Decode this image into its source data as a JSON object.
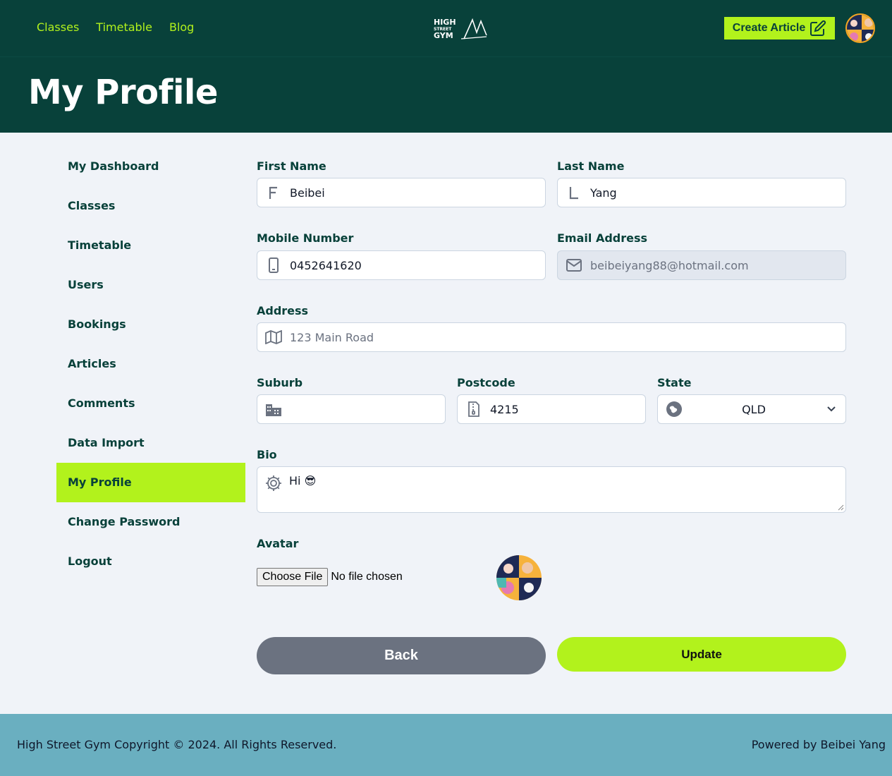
{
  "nav": {
    "links": [
      "Classes",
      "Timetable",
      "Blog"
    ],
    "create_label": "Create Article",
    "logo_text": [
      "HIGH",
      "STREET",
      "GYM"
    ]
  },
  "header": {
    "title": "My Profile"
  },
  "sidebar": {
    "items": [
      {
        "label": "My Dashboard"
      },
      {
        "label": "Classes"
      },
      {
        "label": "Timetable"
      },
      {
        "label": "Users"
      },
      {
        "label": "Bookings"
      },
      {
        "label": "Articles"
      },
      {
        "label": "Comments"
      },
      {
        "label": "Data Import"
      },
      {
        "label": "My Profile",
        "active": true
      },
      {
        "label": "Change Password"
      },
      {
        "label": "Logout"
      }
    ]
  },
  "form": {
    "first_name": {
      "label": "First Name",
      "value": "Beibei"
    },
    "last_name": {
      "label": "Last Name",
      "value": "Yang"
    },
    "mobile": {
      "label": "Mobile Number",
      "value": "0452641620"
    },
    "email": {
      "label": "Email Address",
      "value": "beibeiyang88@hotmail.com"
    },
    "address": {
      "label": "Address",
      "placeholder": "123 Main Road"
    },
    "suburb": {
      "label": "Suburb",
      "value": ""
    },
    "postcode": {
      "label": "Postcode",
      "value": "4215"
    },
    "state": {
      "label": "State",
      "value": "QLD"
    },
    "bio": {
      "label": "Bio",
      "value": "Hi 😎"
    },
    "avatar": {
      "label": "Avatar",
      "button": "Choose File",
      "status": "No file chosen"
    },
    "back_label": "Back",
    "update_label": "Update"
  },
  "footer": {
    "copyright": "High Street Gym Copyright © 2024. All Rights Reserved.",
    "powered": "Powered by Beibei Yang"
  },
  "colors": {
    "primary": "#08413a",
    "accent": "#b2f21c",
    "footer": "#6aafc0",
    "back_button": "#6b7280"
  }
}
